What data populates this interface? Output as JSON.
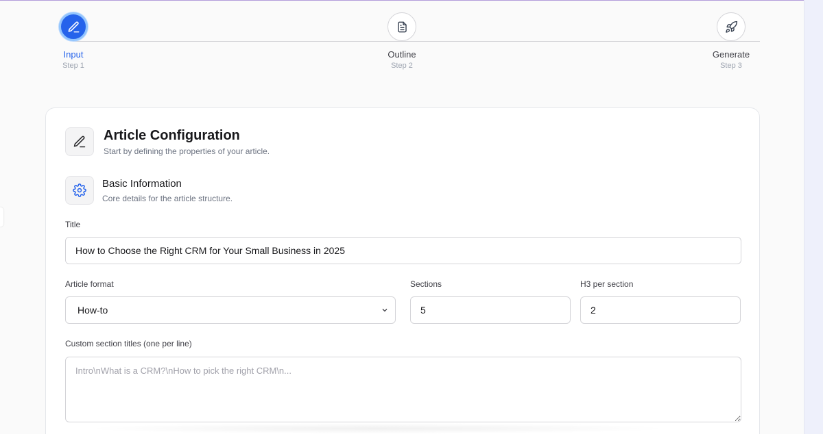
{
  "stepper": {
    "steps": [
      {
        "label": "Input",
        "sub": "Step 1",
        "icon": "pencil-icon",
        "state": "active"
      },
      {
        "label": "Outline",
        "sub": "Step 2",
        "icon": "document-icon",
        "state": "inactive"
      },
      {
        "label": "Generate",
        "sub": "Step 3",
        "icon": "rocket-icon",
        "state": "inactive"
      }
    ]
  },
  "card": {
    "title": "Article Configuration",
    "subtitle": "Start by defining the properties of your article.",
    "header_icon": "pencil-icon"
  },
  "section": {
    "title": "Basic Information",
    "subtitle": "Core details for the article structure.",
    "icon": "gear-icon"
  },
  "form": {
    "title_label": "Title",
    "title_value": "How to Choose the Right CRM for Your Small Business in 2025",
    "format_label": "Article format",
    "format_value": "How-to",
    "sections_label": "Sections",
    "sections_value": "5",
    "h3_label": "H3 per section",
    "h3_value": "2",
    "custom_label": "Custom section titles (one per line)",
    "custom_placeholder": "Intro\\nWhat is a CRM?\\nHow to pick the right CRM\\n..."
  },
  "colors": {
    "accent": "#2563eb",
    "page_bg": "#fafafa",
    "card_bg": "#ffffff"
  }
}
